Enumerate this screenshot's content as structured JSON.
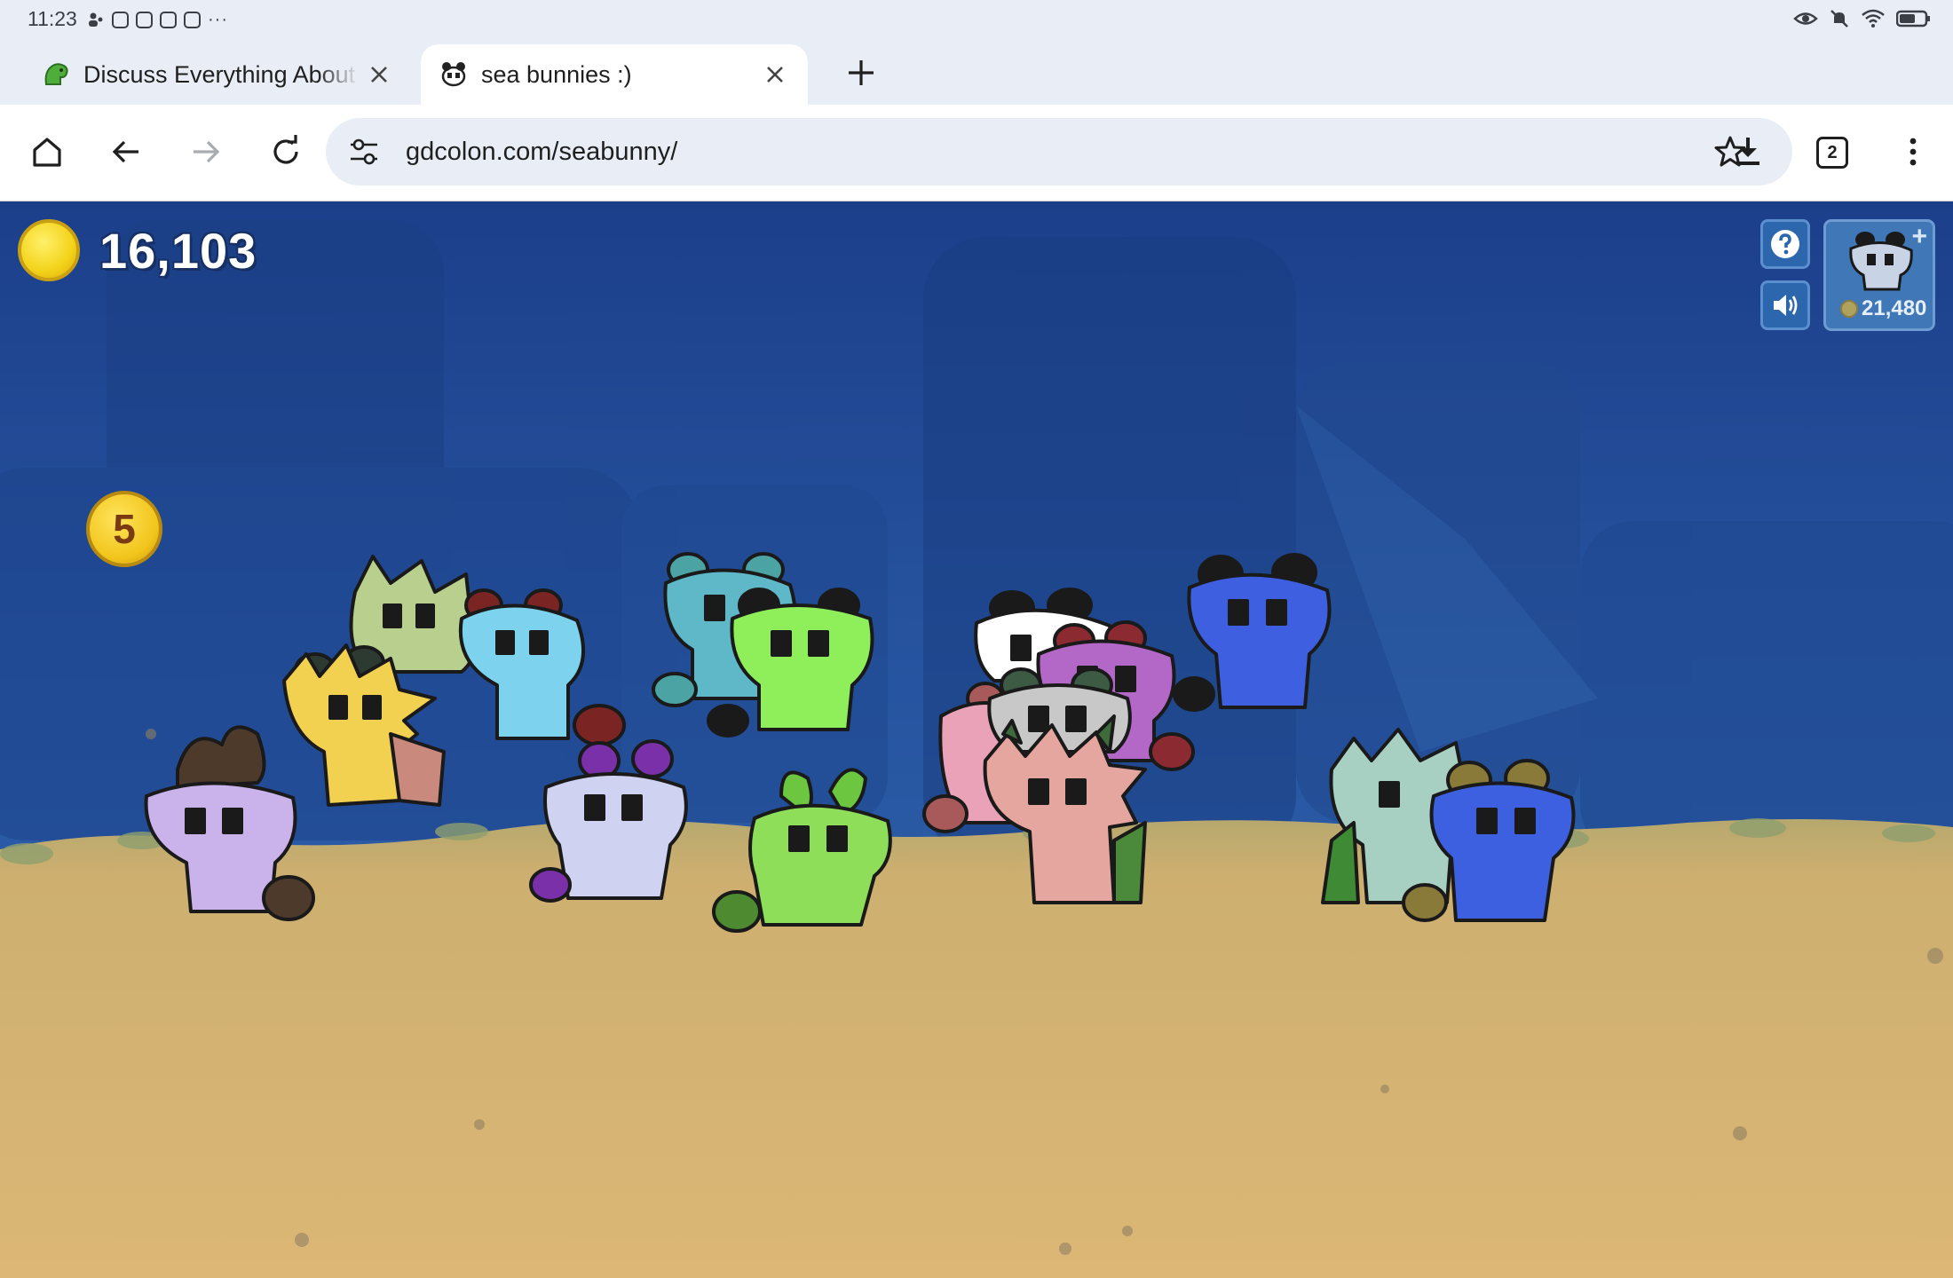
{
  "status_bar": {
    "time": "11:23",
    "more": "···"
  },
  "tabs": [
    {
      "title": "Discuss Everything About B",
      "favicon": "green-dino-icon",
      "active": false
    },
    {
      "title": "sea bunnies :)",
      "favicon": "sea-bunny-icon",
      "active": true
    }
  ],
  "toolbar": {
    "url": "gdcolon.com/seabunny/",
    "tab_count": "2"
  },
  "game": {
    "coins": "16,103",
    "bubble_value": "5",
    "shop_price": "21,480",
    "colors": {
      "water": "#25509c",
      "sand": "#d6b372",
      "coin": "#f3d31a"
    }
  }
}
